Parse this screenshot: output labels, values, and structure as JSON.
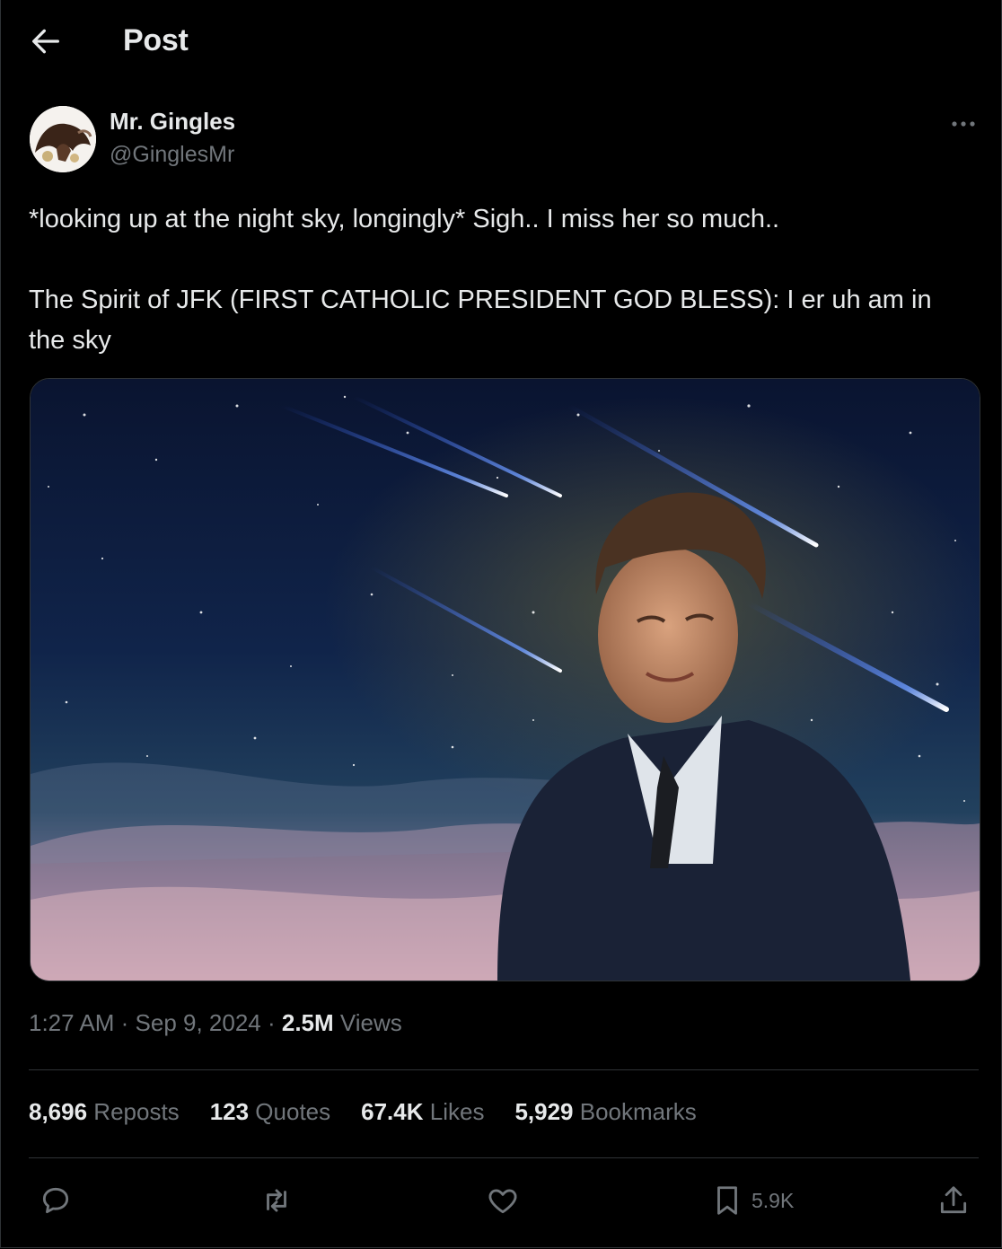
{
  "header": {
    "title": "Post"
  },
  "author": {
    "display_name": "Mr. Gingles",
    "handle": "@GinglesMr"
  },
  "tweet": {
    "line1": "*looking up at the night sky, longingly* Sigh.. I miss her so much..",
    "line2": "The Spirit of JFK (FIRST CATHOLIC PRESIDENT GOD BLESS): I er uh am in the sky"
  },
  "meta": {
    "time": "1:27 AM",
    "sep": " · ",
    "date": "Sep 9, 2024",
    "views_count": "2.5M",
    "views_label": " Views"
  },
  "stats": {
    "reposts_count": "8,696",
    "reposts_label": " Reposts",
    "quotes_count": "123",
    "quotes_label": " Quotes",
    "likes_count": "67.4K",
    "likes_label": " Likes",
    "bookmarks_count": "5,929",
    "bookmarks_label": " Bookmarks"
  },
  "actions": {
    "reply_icon": "reply-icon",
    "repost_icon": "repost-icon",
    "like_icon": "heart-icon",
    "bookmark_icon": "bookmark-icon",
    "bookmark_count": "5.9K",
    "share_icon": "share-icon"
  },
  "colors": {
    "background": "#000000",
    "text": "#e7e9ea",
    "secondary": "#71767b",
    "border": "#2f3336"
  }
}
